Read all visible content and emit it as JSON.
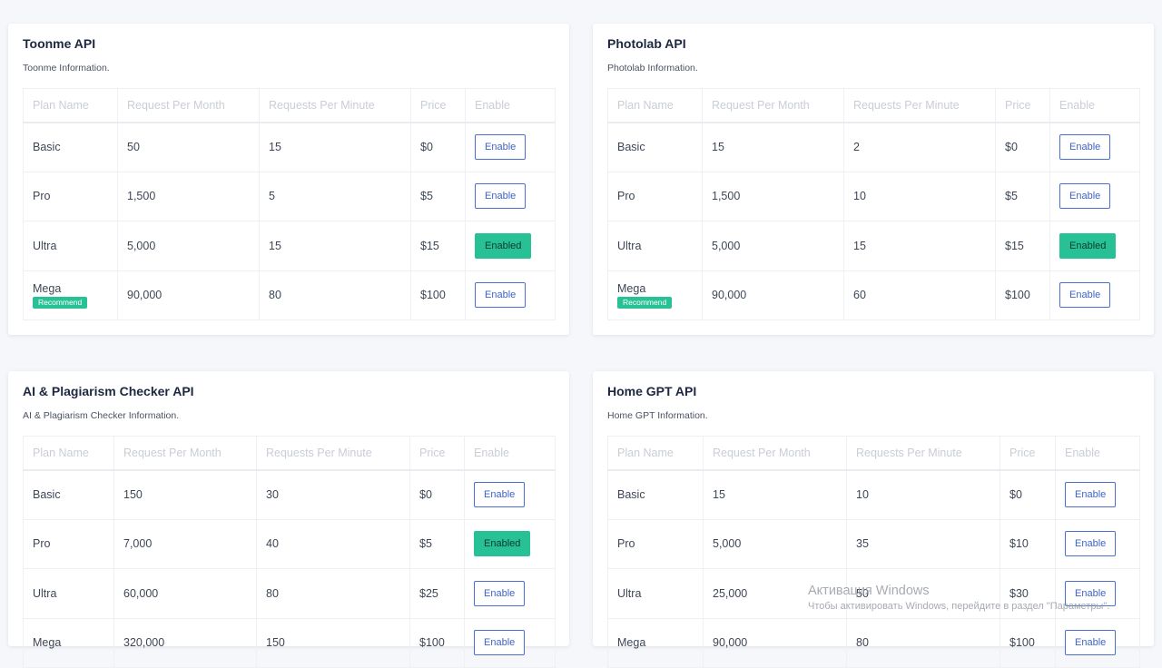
{
  "cards": [
    {
      "title": "Toonme API",
      "subtitle": "Toonme Information.",
      "headers": [
        "Plan Name",
        "Request Per Month",
        "Requests Per Minute",
        "Price",
        "Enable"
      ],
      "rows": [
        {
          "plan": "Basic",
          "month": "50",
          "minute": "15",
          "price": "$0",
          "button": "Enable",
          "badge": ""
        },
        {
          "plan": "Pro",
          "month": "1,500",
          "minute": "5",
          "price": "$5",
          "button": "Enable",
          "badge": ""
        },
        {
          "plan": "Ultra",
          "month": "5,000",
          "minute": "15",
          "price": "$15",
          "button": "Enabled",
          "badge": ""
        },
        {
          "plan": "Mega",
          "month": "90,000",
          "minute": "80",
          "price": "$100",
          "button": "Enable",
          "badge": "Recommend"
        }
      ]
    },
    {
      "title": "Photolab API",
      "subtitle": "Photolab Information.",
      "headers": [
        "Plan Name",
        "Request Per Month",
        "Requests Per Minute",
        "Price",
        "Enable"
      ],
      "rows": [
        {
          "plan": "Basic",
          "month": "15",
          "minute": "2",
          "price": "$0",
          "button": "Enable",
          "badge": ""
        },
        {
          "plan": "Pro",
          "month": "1,500",
          "minute": "10",
          "price": "$5",
          "button": "Enable",
          "badge": ""
        },
        {
          "plan": "Ultra",
          "month": "5,000",
          "minute": "15",
          "price": "$15",
          "button": "Enabled",
          "badge": ""
        },
        {
          "plan": "Mega",
          "month": "90,000",
          "minute": "60",
          "price": "$100",
          "button": "Enable",
          "badge": "Recommend"
        }
      ]
    },
    {
      "title": "AI & Plagiarism Checker API",
      "subtitle": "AI & Plagiarism Checker Information.",
      "headers": [
        "Plan Name",
        "Request Per Month",
        "Requests Per Minute",
        "Price",
        "Enable"
      ],
      "rows": [
        {
          "plan": "Basic",
          "month": "150",
          "minute": "30",
          "price": "$0",
          "button": "Enable",
          "badge": ""
        },
        {
          "plan": "Pro",
          "month": "7,000",
          "minute": "40",
          "price": "$5",
          "button": "Enabled",
          "badge": ""
        },
        {
          "plan": "Ultra",
          "month": "60,000",
          "minute": "80",
          "price": "$25",
          "button": "Enable",
          "badge": ""
        },
        {
          "plan": "Mega",
          "month": "320,000",
          "minute": "150",
          "price": "$100",
          "button": "Enable",
          "badge": ""
        }
      ]
    },
    {
      "title": "Home GPT API",
      "subtitle": "Home GPT Information.",
      "headers": [
        "Plan Name",
        "Request Per Month",
        "Requests Per Minute",
        "Price",
        "Enable"
      ],
      "rows": [
        {
          "plan": "Basic",
          "month": "15",
          "minute": "10",
          "price": "$0",
          "button": "Enable",
          "badge": ""
        },
        {
          "plan": "Pro",
          "month": "5,000",
          "minute": "35",
          "price": "$10",
          "button": "Enable",
          "badge": ""
        },
        {
          "plan": "Ultra",
          "month": "25,000",
          "minute": "50",
          "price": "$30",
          "button": "Enable",
          "badge": ""
        },
        {
          "plan": "Mega",
          "month": "90,000",
          "minute": "80",
          "price": "$100",
          "button": "Enable",
          "badge": ""
        }
      ]
    }
  ],
  "watermark": {
    "line1": "Активация Windows",
    "line2": "Чтобы активировать Windows, перейдите в раздел \"Параметры\"."
  },
  "colors": {
    "accent": "#4a6fd1",
    "enabled": "#28c195",
    "background": "#f6f7fb"
  }
}
